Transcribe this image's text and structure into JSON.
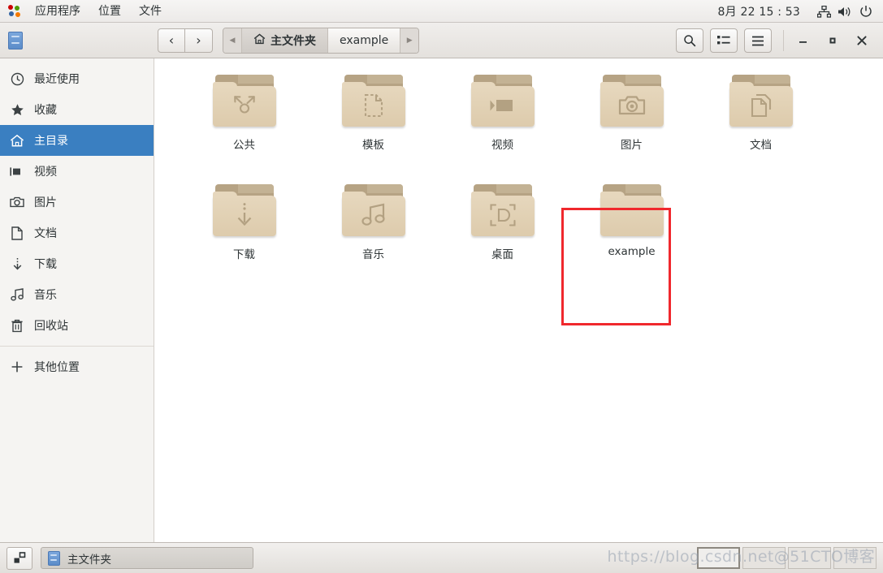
{
  "panel": {
    "apps_icon": "applications-icon",
    "menus": [
      {
        "label": "应用程序",
        "name": "panel-menu-applications"
      },
      {
        "label": "位置",
        "name": "panel-menu-places"
      },
      {
        "label": "文件",
        "name": "panel-menu-files"
      }
    ],
    "clock": "8月 22  15 : 53",
    "indicators": [
      {
        "name": "network-icon",
        "glyph": "network"
      },
      {
        "name": "volume-icon",
        "glyph": "volume"
      },
      {
        "name": "power-icon",
        "glyph": "power"
      }
    ]
  },
  "headerbar": {
    "app_icon": "file-cabinet-icon",
    "back_label": "‹",
    "forward_label": "›",
    "breadcrumb_prev": "◀",
    "breadcrumb_next": "▶",
    "crumbs": [
      {
        "label": "主文件夹",
        "icon": "home-icon",
        "active": true
      },
      {
        "label": "example",
        "icon": "",
        "active": false
      }
    ],
    "search_label": "search-icon",
    "view_label": "list-view-icon",
    "menu_label": "hamburger-menu-icon",
    "minimize": "—",
    "maximize": "▫",
    "close": "✕"
  },
  "sidebar": {
    "items": [
      {
        "label": "最近使用",
        "icon": "clock-icon",
        "selected": false
      },
      {
        "label": "收藏",
        "icon": "star-icon",
        "selected": false
      },
      {
        "label": "主目录",
        "icon": "home-icon",
        "selected": true
      },
      {
        "label": "视频",
        "icon": "video-camera-icon",
        "selected": false
      },
      {
        "label": "图片",
        "icon": "camera-icon",
        "selected": false
      },
      {
        "label": "文档",
        "icon": "document-icon",
        "selected": false
      },
      {
        "label": "下载",
        "icon": "download-icon",
        "selected": false
      },
      {
        "label": "音乐",
        "icon": "music-note-icon",
        "selected": false
      },
      {
        "label": "回收站",
        "icon": "trash-icon",
        "selected": false
      }
    ],
    "other_locations": {
      "label": "其他位置",
      "icon": "plus-icon"
    }
  },
  "files": [
    {
      "label": "公共",
      "emblem": "share-icon"
    },
    {
      "label": "模板",
      "emblem": "template-document-icon"
    },
    {
      "label": "视频",
      "emblem": "video-icon"
    },
    {
      "label": "图片",
      "emblem": "camera-icon"
    },
    {
      "label": "文档",
      "emblem": "documents-icon"
    },
    {
      "label": "下载",
      "emblem": "download-arrow-icon"
    },
    {
      "label": "音乐",
      "emblem": "music-icon"
    },
    {
      "label": "桌面",
      "emblem": "desktop-icon"
    },
    {
      "label": "example",
      "emblem": "none"
    }
  ],
  "highlight": {
    "target_label": "example",
    "color": "#f0282d"
  },
  "taskbar": {
    "show_desktop_icon": "show-desktop-icon",
    "task": {
      "label": "主文件夹",
      "icon": "file-cabinet-icon"
    },
    "workspaces": [
      {
        "active": true
      },
      {
        "active": false
      },
      {
        "active": false
      },
      {
        "active": false
      }
    ]
  },
  "watermark": "https://blog.csdn.net@51CTO博客",
  "colors": {
    "selection_blue": "#3a7fc1",
    "folder_front": "#e6d7bd",
    "folder_tab": "#b6a384",
    "highlight_red": "#f0282d"
  }
}
